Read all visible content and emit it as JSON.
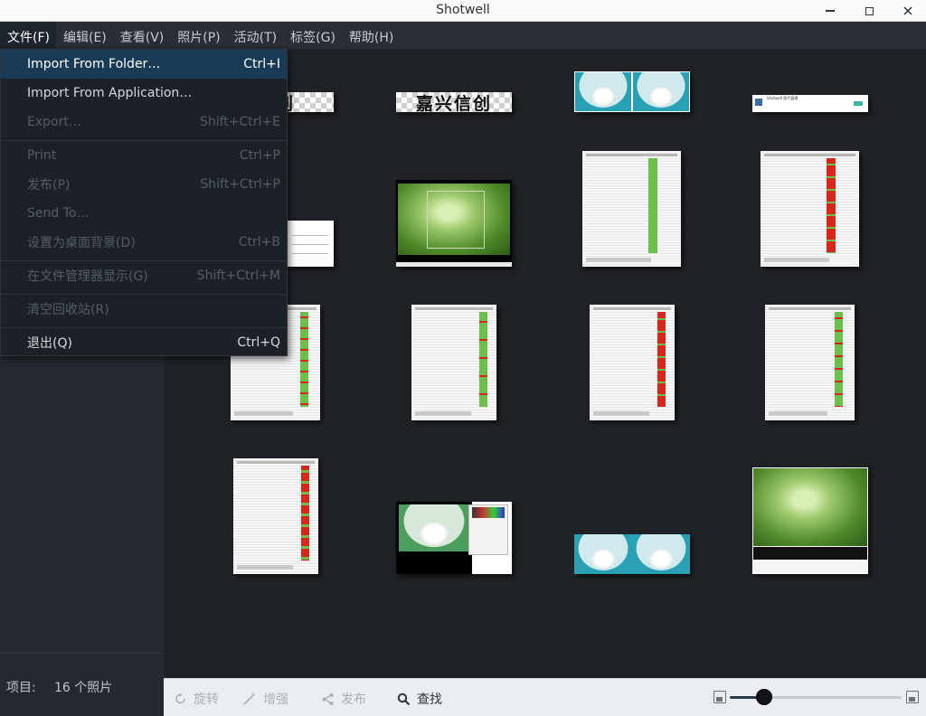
{
  "window": {
    "title": "Shotwell"
  },
  "menubar": [
    "文件(F)",
    "编辑(E)",
    "查看(V)",
    "照片(P)",
    "活动(T)",
    "标签(G)",
    "帮助(H)"
  ],
  "file_menu": [
    {
      "label": "Import From Folder…",
      "accel": "Ctrl+I",
      "state": "highlighted"
    },
    {
      "label": "Import From Application…",
      "accel": "",
      "state": "enabled"
    },
    {
      "label": "Export…",
      "accel": "Shift+Ctrl+E",
      "state": "disabled"
    },
    {
      "label": "Print",
      "accel": "Ctrl+P",
      "state": "disabled"
    },
    {
      "label": "发布(P)",
      "accel": "Shift+Ctrl+P",
      "state": "disabled"
    },
    {
      "label": "Send To…",
      "accel": "",
      "state": "disabled"
    },
    {
      "label": "设置为桌面背景(D)",
      "accel": "Ctrl+B",
      "state": "disabled"
    },
    {
      "label": "在文件管理器显示(G)",
      "accel": "Shift+Ctrl+M",
      "state": "disabled"
    },
    {
      "label": "清空回收站(R)",
      "accel": "",
      "state": "disabled"
    },
    {
      "label": "退出(Q)",
      "accel": "Ctrl+Q",
      "state": "enabled"
    }
  ],
  "status": {
    "label": "项目:",
    "value": "16 个照片"
  },
  "toolbar": {
    "rotate": "旋转",
    "enhance": "增强",
    "publish": "发布",
    "find": "查找"
  },
  "zoom": {
    "level": 0.2
  },
  "photos": [
    {
      "kind": "banner",
      "text": "信创"
    },
    {
      "kind": "banner",
      "text": "嘉兴信创"
    },
    {
      "kind": "rabbits"
    },
    {
      "kind": "app-shot",
      "text": "Shotwell 照片管理"
    },
    {
      "kind": "doc"
    },
    {
      "kind": "plant-viewer"
    },
    {
      "kind": "sheet-green"
    },
    {
      "kind": "sheet-red"
    },
    {
      "kind": "sheet-green"
    },
    {
      "kind": "sheet-green"
    },
    {
      "kind": "sheet-red"
    },
    {
      "kind": "sheet-green"
    },
    {
      "kind": "sheet-green"
    },
    {
      "kind": "rabbit-editor"
    },
    {
      "kind": "rabbits"
    },
    {
      "kind": "plant-viewer"
    }
  ]
}
